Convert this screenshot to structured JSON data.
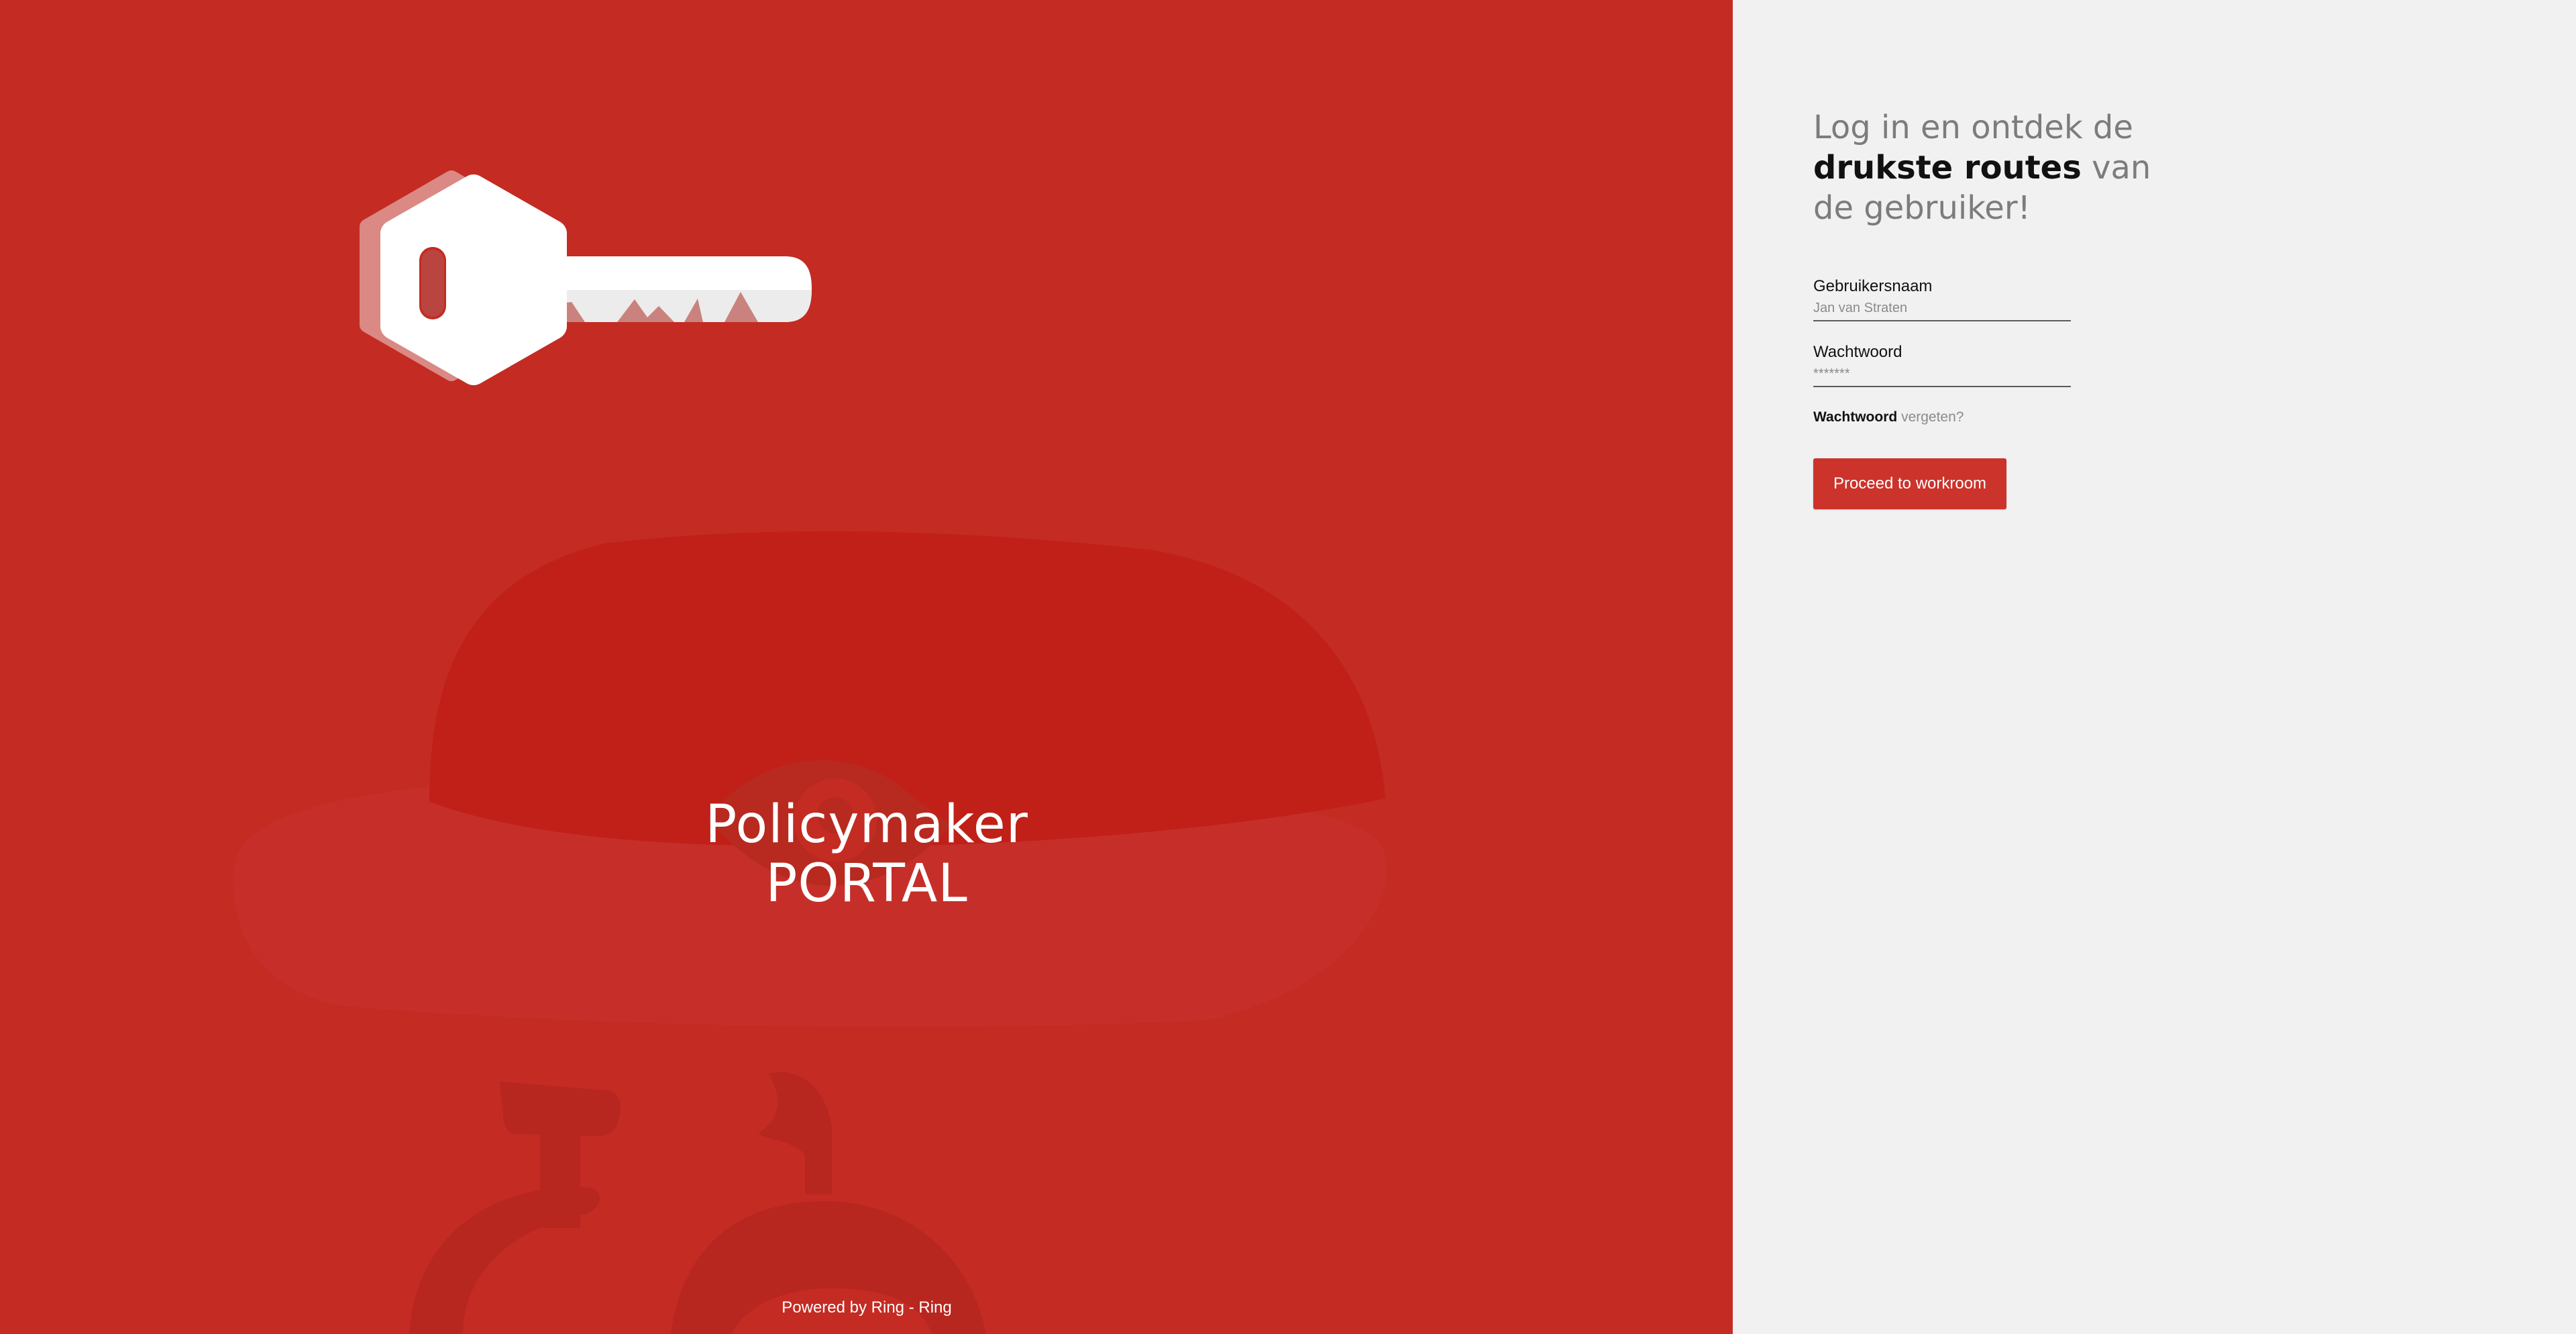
{
  "brand": {
    "title_line1": "Policymaker",
    "title_line2": "PORTAL",
    "powered_by": "Powered by Ring - Ring"
  },
  "login": {
    "tagline_part1": "Log in en ontdek de",
    "tagline_bold": "drukste routes",
    "tagline_part2": "van",
    "tagline_part3": "de gebruiker!",
    "username_label": "Gebruikersnaam",
    "username_placeholder": "Jan van Straten",
    "password_label": "Wachtwoord",
    "password_placeholder": "*******",
    "forgot_bold": "Wachtwoord",
    "forgot_rest": "vergeten?",
    "proceed_button": "Proceed to workroom"
  },
  "icons": {
    "hero": "key-icon",
    "background": "bicycle-helmet-illustration"
  },
  "colors": {
    "brand_red": "#c42b23",
    "button_red": "#cb332b",
    "panel_bg": "#f1f1f1"
  }
}
